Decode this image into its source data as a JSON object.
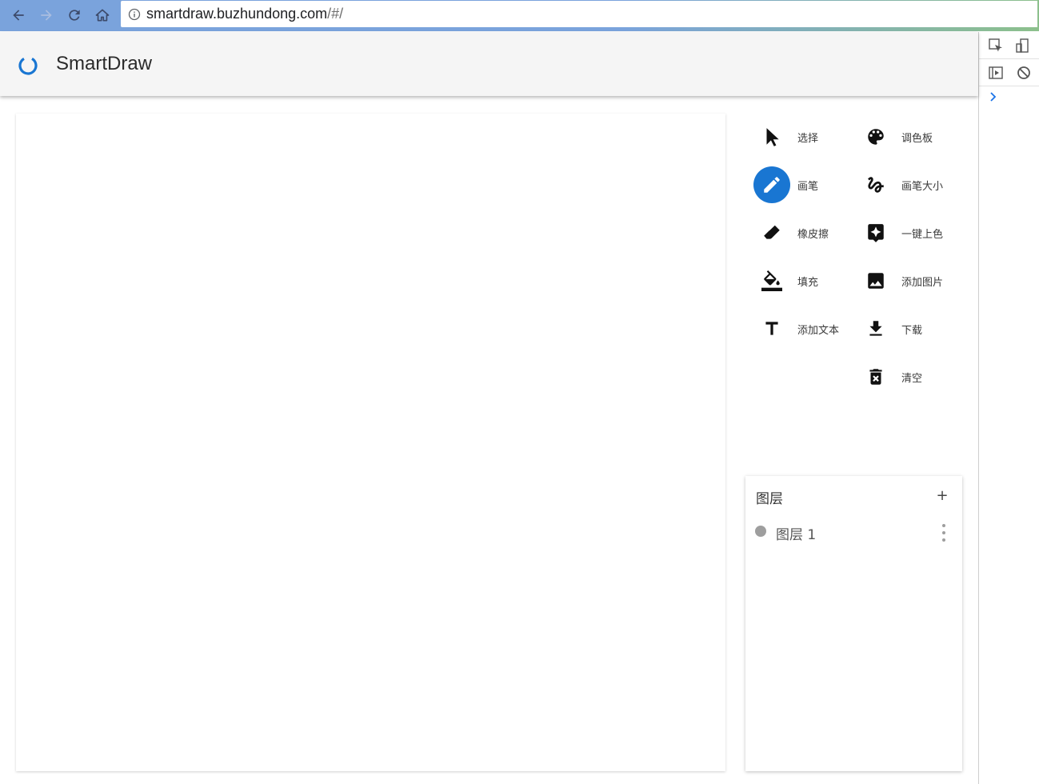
{
  "browser": {
    "url_host": "smartdraw.buzhundong.com",
    "url_rest": "/#/"
  },
  "app": {
    "title": "SmartDraw"
  },
  "tools_left": [
    {
      "label": "选择",
      "icon": "cursor-icon",
      "active": false
    },
    {
      "label": "画笔",
      "icon": "pencil-icon",
      "active": true
    },
    {
      "label": "橡皮擦",
      "icon": "eraser-icon",
      "active": false
    },
    {
      "label": "填充",
      "icon": "fill-bucket-icon",
      "active": false
    },
    {
      "label": "添加文本",
      "icon": "text-icon",
      "active": false
    }
  ],
  "tools_right": [
    {
      "label": "调色板",
      "icon": "palette-icon"
    },
    {
      "label": "画笔大小",
      "icon": "gesture-icon"
    },
    {
      "label": "一键上色",
      "icon": "auto-color-icon"
    },
    {
      "label": "添加图片",
      "icon": "image-icon"
    },
    {
      "label": "下载",
      "icon": "download-icon"
    },
    {
      "label": "清空",
      "icon": "delete-icon"
    }
  ],
  "layers": {
    "title": "图层",
    "add_label": "+",
    "items": [
      {
        "name": "图层 1"
      }
    ]
  },
  "colors": {
    "accent": "#1976d2",
    "header_bg": "#f5f5f5",
    "browser_bar": "#7aa3dc"
  }
}
